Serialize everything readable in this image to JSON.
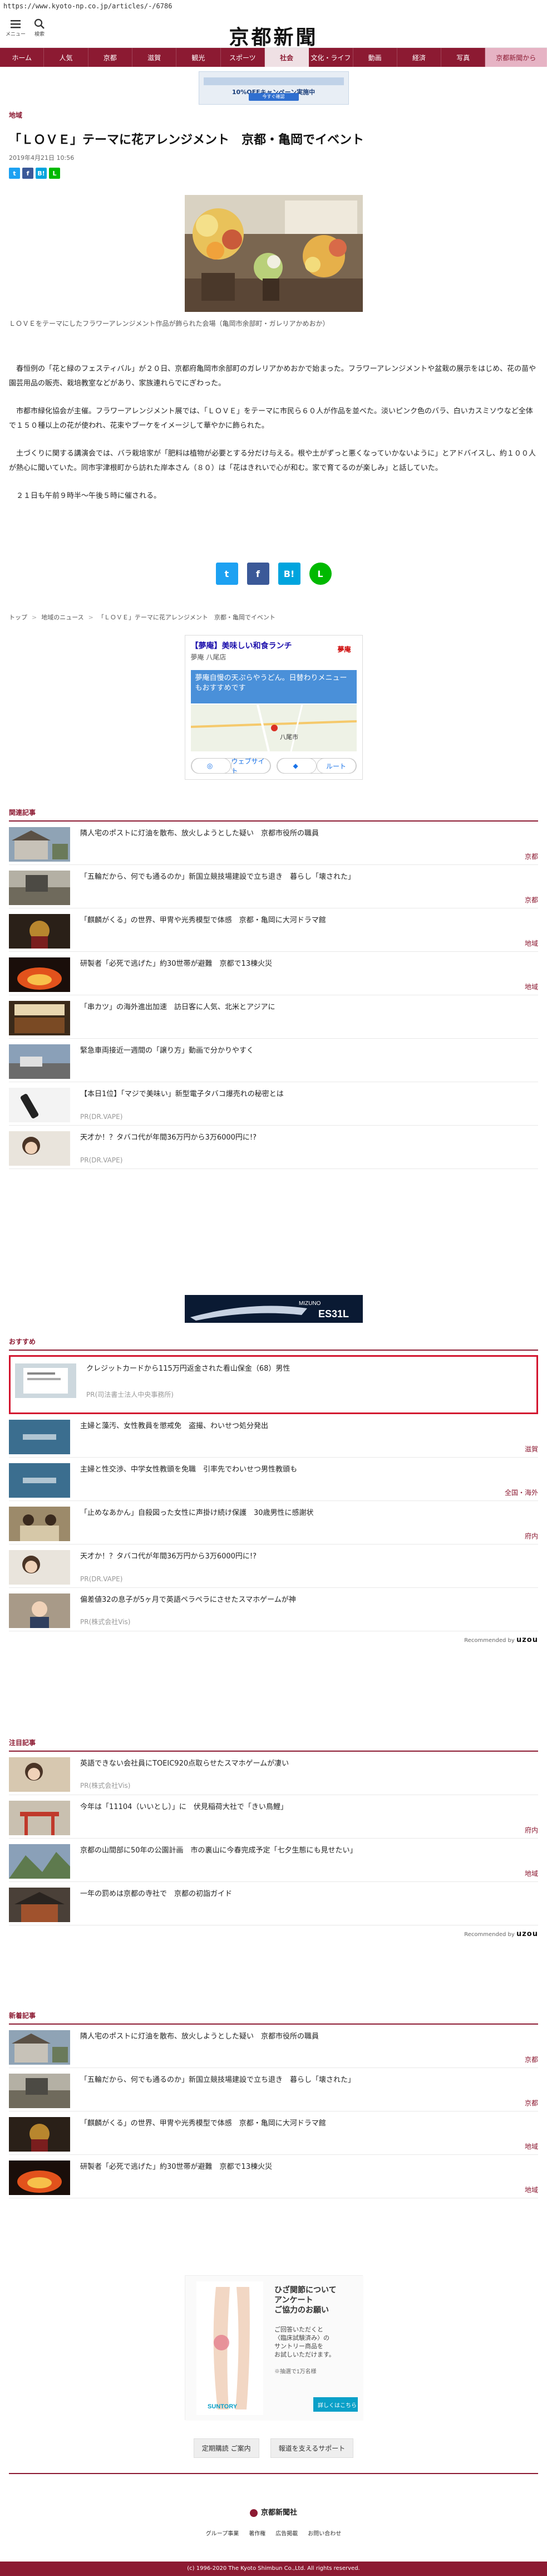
{
  "url": "https://www.kyoto-np.co.jp/articles/-/6786",
  "header": {
    "menu_label": "メニュー",
    "search_label": "検索",
    "logo": "京都新聞"
  },
  "nav": [
    "ホーム",
    "人気",
    "京都",
    "滋賀",
    "観光",
    "スポーツ",
    "社会",
    "文化・ライフ",
    "動画",
    "経済",
    "写真",
    "京都新聞から"
  ],
  "top_ad": {
    "title": "10%OFFキャンペーン実施中",
    "button": "今すぐ確認"
  },
  "article": {
    "category": "地域",
    "title": "「ＬＯＶＥ」テーマに花アレンジメント　京都・亀岡でイベント",
    "date": "2019年4月21日 10:56",
    "caption": "ＬＯＶＥをテーマにしたフラワーアレンジメント作品が飾られた会場（亀岡市余部町・ガレリアかめおか）",
    "paragraphs": [
      "　春恒例の「花と緑のフェスティバル」が２０日、京都府亀岡市余部町のガレリアかめおかで始まった。フラワーアレンジメントや盆栽の展示をはじめ、花の苗や園芸用品の販売、栽培教室などがあり、家族連れらでにぎわった。",
      "　市都市緑化協会が主催。フラワーアレンジメント展では、「ＬＯＶＥ」をテーマに市民ら６０人が作品を並べた。淡いピンク色のバラ、白いカスミソウなど全体で１５０種以上の花が使われ、花束やブーケをイメージして華やかに飾られた。",
      "　土づくりに関する講演会では、バラ栽培家が「肥料は植物が必要とする分だけ与える。根や土がずっと悪くなっていかないように」とアドバイスし、約１００人が熱心に聞いていた。同市宇津根町から訪れた岸本さん（８０）は「花はきれいで心が和む。家で育てるのが楽しみ」と話していた。",
      "　２１日も午前９時半〜午後５時に催される。"
    ]
  },
  "breadcrumb": [
    "トップ",
    "地域のニュース",
    "「ＬＯＶＥ」テーマに花アレンジメント　京都・亀岡でイベント"
  ],
  "map_ad": {
    "title": "【夢庵】美味しい和食ランチ",
    "subtitle": "夢庵 八尾店",
    "logo": "夢庵",
    "body": "夢庵自慢の天ぷらやうどん。日替わりメニューもおすすめです",
    "place": "八尾市",
    "website": "ウェブサイト",
    "route": "ルート"
  },
  "related": {
    "heading": "関連記事",
    "items": [
      {
        "title": "隣人宅のポストに灯油を散布、放火しようとした疑い　京都市役所の職員",
        "tag": "京都"
      },
      {
        "title": "「五輪だから、何でも通るのか」新国立競技場建設で立ち退き　暮らし「壊された」",
        "tag": "京都"
      },
      {
        "title": "「麒麟がくる」の世界、甲冑や光秀模型で体感　京都・亀岡に大河ドラマ館",
        "tag": "地域"
      },
      {
        "title": "研製者「必死で逃げた」約30世帯が避難　京都で13棟火災",
        "tag": "地域"
      },
      {
        "title": "「串カツ」の海外進出加速　訪日客に人気、北米とアジアに",
        "tag": ""
      },
      {
        "title": "緊急車両接近一週間の「譲り方」動画で分かりやすく",
        "tag": ""
      },
      {
        "title": "【本日1位】「マジで美味い」新型電子タバコ爆売れの秘密とは",
        "pr": "PR(DR.VAPE)"
      },
      {
        "title": "天才か！？タバコ代が年間36万円から3万6000円に!?",
        "pr": "PR(DR.VAPE)"
      }
    ]
  },
  "mid_ad": {
    "brand": "MIZUNO",
    "model": "ES31L"
  },
  "recommend": {
    "heading": "おすすめ",
    "items": [
      {
        "title": "クレジットカードから115万円返金された看山保金（68）男性",
        "pr": "PR(司法書士法人中央事務所)"
      },
      {
        "title": "主婦と藻汚、女性教員を懲戒免　盗撮、わいせつ処分発出",
        "tag": "滋賀"
      },
      {
        "title": "主婦と性交渉、中学女性教頭を免職　引率先でわいせつ男性教頭も",
        "tag": "全国・海外"
      },
      {
        "title": "「止めなあかん」自殺図った女性に声掛け続け保護　30歳男性に感謝状",
        "tag": "府内"
      },
      {
        "title": "天才か！？タバコ代が年間36万円から3万6000円に!?",
        "pr": "PR(DR.VAPE)"
      },
      {
        "title": "偏差値32の息子が5ヶ月で英語ペラペラにさせたスマホゲームが神",
        "pr": "PR(株式会社Vis)"
      }
    ]
  },
  "credit_label": "Recommended by",
  "credit_brand": "uzou",
  "attention": {
    "heading": "注目記事",
    "items": [
      {
        "title": "英語できない会社員にTOEIC920点取らせたスマホゲームが凄い",
        "pr": "PR(株式会社Vis)"
      },
      {
        "title": "今年は「11104（いいとし）」に　伏見稲荷大社で「きい鳥鯉」",
        "tag": "府内"
      },
      {
        "title": "京都の山間部に50年の公園計画　市の裏山に今春完成予定「七夕生態にも見せたい」",
        "tag": "地域"
      },
      {
        "title": "一年の罰めは京都の寺社で　京都の初詣ガイド",
        "tag": ""
      }
    ]
  },
  "latest": {
    "heading": "新着記事",
    "items": [
      {
        "title": "隣人宅のポストに灯油を散布、放火しようとした疑い　京都市役所の職員",
        "tag": "京都"
      },
      {
        "title": "「五輪だから、何でも通るのか」新国立競技場建設で立ち退き　暮らし「壊された」",
        "tag": "京都"
      },
      {
        "title": "「麒麟がくる」の世界、甲冑や光秀模型で体感　京都・亀岡に大河ドラマ館",
        "tag": "地域"
      },
      {
        "title": "研製者「必死で逃げた」約30世帯が避難　京都で13棟火災",
        "tag": "地域"
      }
    ]
  },
  "foot_ad": {
    "heading": "ひざ関節について\nアンケート\nご協力のお願い",
    "body": "ご回答いただくと\n〈臨床試験済み〉の\nサントリー商品を\nお試しいただけます。",
    "note": "※抽選で1万名様",
    "brand": "SUNTORY",
    "cta": "詳しくはこちら"
  },
  "footer": {
    "buttons": [
      "定期購読 ご案内",
      "報道を支えるサポート"
    ],
    "company": "京都新聞社",
    "links": [
      "グループ事業",
      "著作権",
      "広告掲載",
      "お問い合わせ"
    ],
    "copyright": "(c) 1996-2020 The Kyoto Shimbun Co.,Ltd. All rights reserved."
  },
  "colors": {
    "brand": "#8c1a32",
    "highlight": "#d3152f"
  }
}
